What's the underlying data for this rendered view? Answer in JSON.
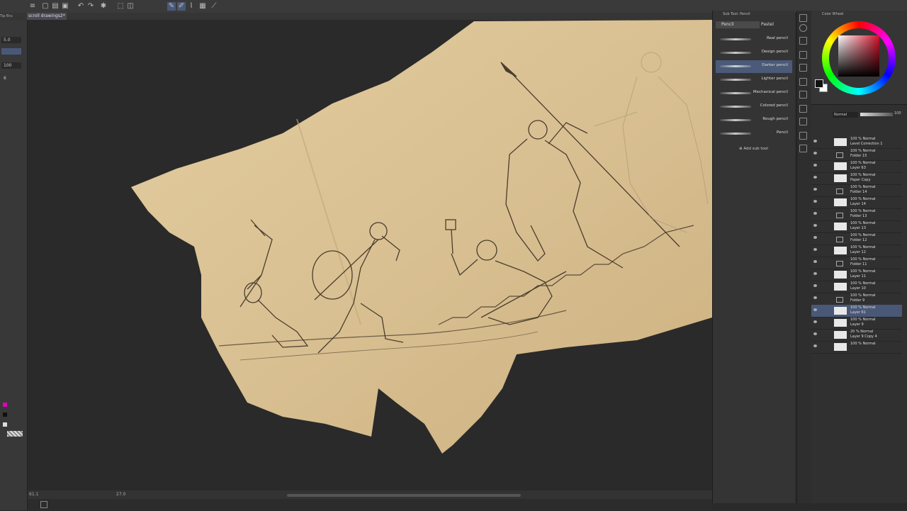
{
  "app": {
    "document_tab": "scroll drawings2*",
    "left_tab": "Tip Bru"
  },
  "tool_property": {
    "brush_size": "5.0",
    "opacity": "100",
    "extra": "6"
  },
  "status": {
    "zoom": "61.1",
    "angle": "27.0"
  },
  "sub_tool": {
    "header": "Sub Tool: Pencil",
    "tabs": [
      "Pencil",
      "Pastel"
    ],
    "brushes": [
      {
        "label": "Real pencil",
        "selected": false
      },
      {
        "label": "Design pencil",
        "selected": false
      },
      {
        "label": "Darker pencil",
        "selected": true
      },
      {
        "label": "Lighter pencil",
        "selected": false
      },
      {
        "label": "Mechanical pencil",
        "selected": false
      },
      {
        "label": "Colored pencil",
        "selected": false
      },
      {
        "label": "Rough pencil",
        "selected": false
      },
      {
        "label": "Pencil",
        "selected": false
      }
    ],
    "add_label": "Add sub tool"
  },
  "color_panel": {
    "header": "Color Wheel",
    "fg_color": "#111111",
    "bg_color": "#ffffff",
    "hue_color": "#d0122a"
  },
  "layers": {
    "blend_mode": "Normal",
    "opacity": "100",
    "rows": [
      {
        "l1": "100 % Normal",
        "l2": "Level Correction 1",
        "type": "layer",
        "selected": false
      },
      {
        "l1": "100 % Normal",
        "l2": "Folder 15",
        "type": "folder",
        "selected": false
      },
      {
        "l1": "100 % Normal",
        "l2": "Layer 63",
        "type": "layer",
        "selected": false
      },
      {
        "l1": "100 % Normal",
        "l2": "Paper Copy",
        "type": "layer",
        "selected": false
      },
      {
        "l1": "100 % Normal",
        "l2": "Folder 14",
        "type": "folder",
        "selected": false
      },
      {
        "l1": "100 % Normal",
        "l2": "Layer 14",
        "type": "layer",
        "selected": false
      },
      {
        "l1": "100 % Normal",
        "l2": "Folder 13",
        "type": "folder",
        "selected": false
      },
      {
        "l1": "100 % Normal",
        "l2": "Layer 13",
        "type": "layer",
        "selected": false
      },
      {
        "l1": "100 % Normal",
        "l2": "Folder 12",
        "type": "folder",
        "selected": false
      },
      {
        "l1": "100 % Normal",
        "l2": "Layer 12",
        "type": "layer",
        "selected": false
      },
      {
        "l1": "100 % Normal",
        "l2": "Folder 11",
        "type": "folder",
        "selected": false
      },
      {
        "l1": "100 % Normal",
        "l2": "Layer 11",
        "type": "layer",
        "selected": false
      },
      {
        "l1": "100 % Normal",
        "l2": "Layer 10",
        "type": "layer",
        "selected": false
      },
      {
        "l1": "100 % Normal",
        "l2": "Folder 9",
        "type": "folder",
        "selected": false
      },
      {
        "l1": "100 % Normal",
        "l2": "Layer 61",
        "type": "layer",
        "selected": true
      },
      {
        "l1": "100 % Normal",
        "l2": "Layer 9",
        "type": "layer",
        "selected": false
      },
      {
        "l1": "20 % Normal",
        "l2": "Layer 9 Copy 4",
        "type": "layer",
        "selected": false
      },
      {
        "l1": "100 % Normal",
        "l2": "",
        "type": "layer",
        "selected": false
      }
    ]
  }
}
